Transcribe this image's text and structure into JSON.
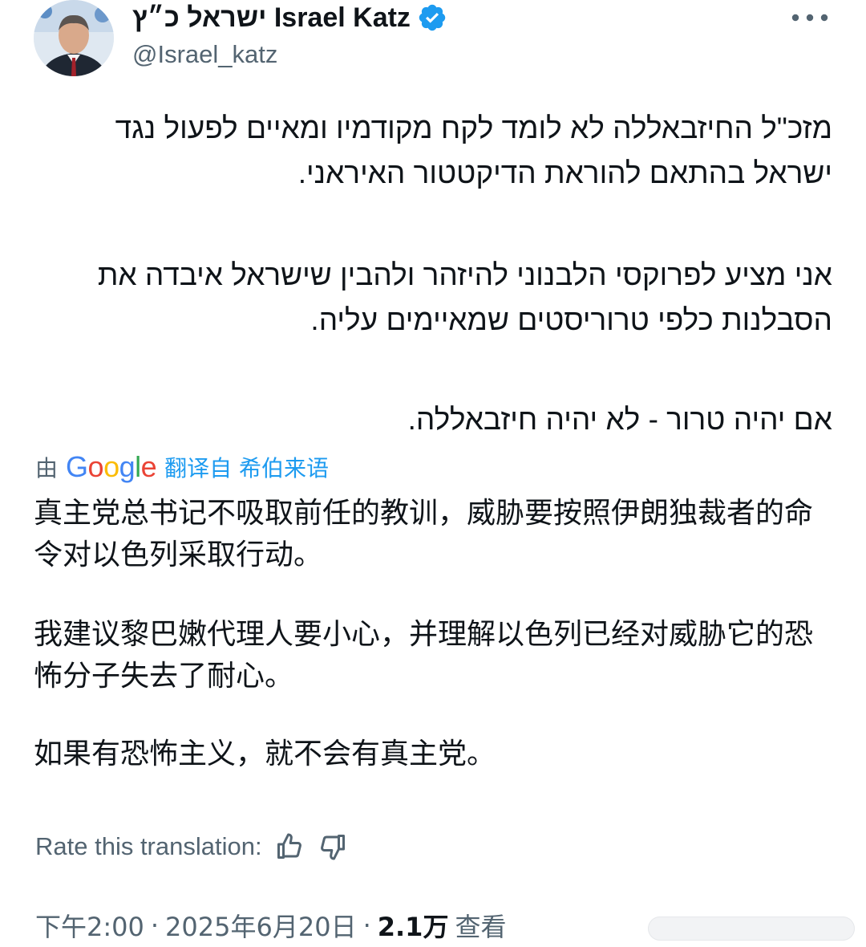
{
  "author": {
    "display_name": "ישראל כ״ץ Israel Katz",
    "handle": "@Israel_katz",
    "verified": true,
    "avatar_icon": "avatar-photo"
  },
  "more_icon": "more-horizontal-icon",
  "original_text": {
    "paragraphs": [
      "מזכ\"ל החיזבאללה לא לומד לקח מקודמיו ומאיים לפעול נגד ישראל בהתאם להוראת הדיקטטור האיראני.",
      "אני מציע לפרוקסי הלבנוני להיזהר ולהבין שישראל איבדה את הסבלנות כלפי טרוריסטים שמאיימים עליה.",
      "אם יהיה טרור - לא יהיה חיזבאללה."
    ]
  },
  "translation": {
    "by_label": "由",
    "provider": "Google",
    "link_label": "翻译自 希伯来语",
    "paragraphs": [
      "真主党总书记不吸取前任的教训，威胁要按照伊朗独裁者的命令对以色列采取行动。",
      "我建议黎巴嫩代理人要小心，并理解以色列已经对威胁它的恐怖分子失去了耐心。",
      "如果有恐怖主义，就不会有真主党。"
    ],
    "rate_label": "Rate this translation:"
  },
  "meta": {
    "time": "下午2:00",
    "separator": "·",
    "date": "2025年6月20日",
    "views_count": "2.1万",
    "views_label": "查看"
  },
  "colors": {
    "text": "#0f1419",
    "secondary": "#536471",
    "link": "#1d9bf0",
    "verified": "#1d9bf0",
    "google_blue": "#4285F4",
    "google_red": "#EA4335",
    "google_yellow": "#FBBC05",
    "google_green": "#34A853"
  }
}
